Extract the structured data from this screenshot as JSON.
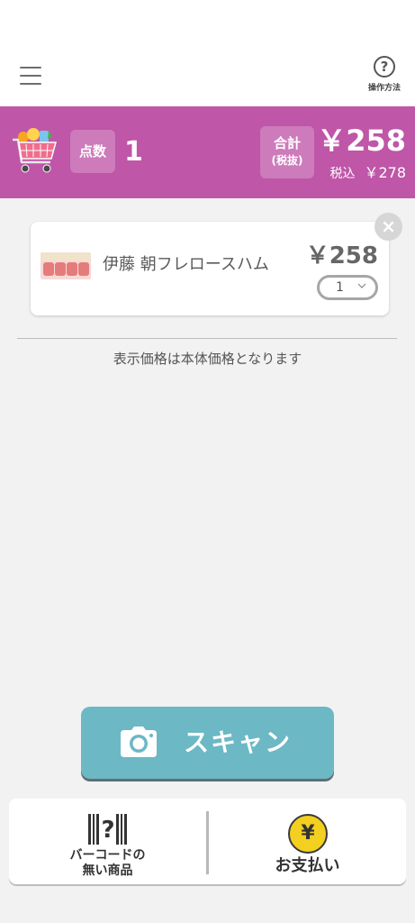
{
  "header": {
    "menu_icon": "hamburger-menu-icon",
    "help_icon": "question-circle-icon",
    "help_label": "操作方法"
  },
  "summary": {
    "background_color": "#bf56a8",
    "cart_icon": "shopping-cart-icon",
    "count_label": "点数",
    "count_value": "1",
    "total_label_line1": "合計",
    "total_label_line2": "(税抜)",
    "total_value": "￥258",
    "tax_included_label": "税込",
    "tax_included_value": "￥278"
  },
  "cart_items": [
    {
      "name": "伊藤  朝フレロースハム",
      "price": "￥258",
      "quantity": "1",
      "remove_icon": "close-icon"
    }
  ],
  "note": "表示価格は本体価格となります",
  "scan_button": {
    "label": "スキャン",
    "icon": "camera-icon",
    "color": "#6cb8c5"
  },
  "bottom_nav": {
    "no_barcode_label_line1": "バーコードの",
    "no_barcode_label_line2": "無い商品",
    "no_barcode_icon": "barcode-question-icon",
    "pay_label": "お支払い",
    "pay_icon_symbol": "¥",
    "pay_icon_color": "#f3cf20"
  }
}
